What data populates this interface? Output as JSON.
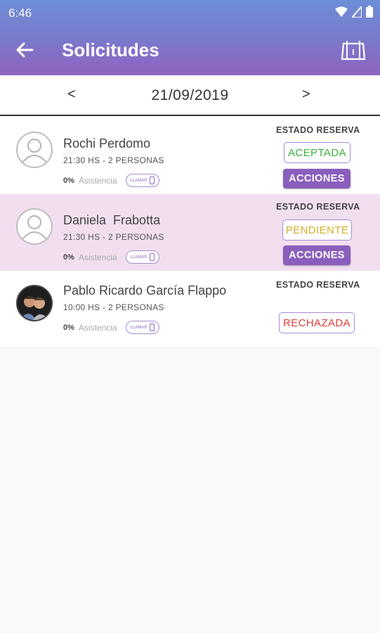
{
  "status_bar": {
    "time": "6:46"
  },
  "app_bar": {
    "title": "Solicitudes",
    "back_icon": "arrow-left-icon",
    "action_icon": "calendar-icon"
  },
  "date_nav": {
    "prev": "<",
    "date": "21/09/2019",
    "next": ">"
  },
  "requests": [
    {
      "name": "Rochi Perdomo",
      "details": "21:30 HS - 2 PERSONAS",
      "attendance_pct": "0%",
      "attendance_label": "Asistencia",
      "call_label": "LLAMAR",
      "estado_label": "ESTADO RESERVA",
      "status": "ACEPTADA",
      "status_color": "#3bb23b",
      "actions_label": "ACCIONES"
    },
    {
      "name": "Daniela  Frabotta",
      "details": "21:30 HS - 2 PERSONAS",
      "attendance_pct": "0%",
      "attendance_label": "Asistencia",
      "call_label": "LLAMAR",
      "estado_label": "ESTADO RESERVA",
      "status": "PENDIENTE",
      "status_color": "#d2b02c",
      "actions_label": "ACCIONES"
    },
    {
      "name": "Pablo Ricardo García Flappo",
      "details": "10:00 HS - 2 PERSONAS",
      "attendance_pct": "0%",
      "attendance_label": "Asistencia",
      "call_label": "LLAMAR",
      "estado_label": "ESTADO RESERVA",
      "status": "RECHAZADA",
      "status_color": "#e53b3b"
    }
  ],
  "colors": {
    "accent": "#8a5ebd",
    "highlight_row": "#f1dff0"
  }
}
